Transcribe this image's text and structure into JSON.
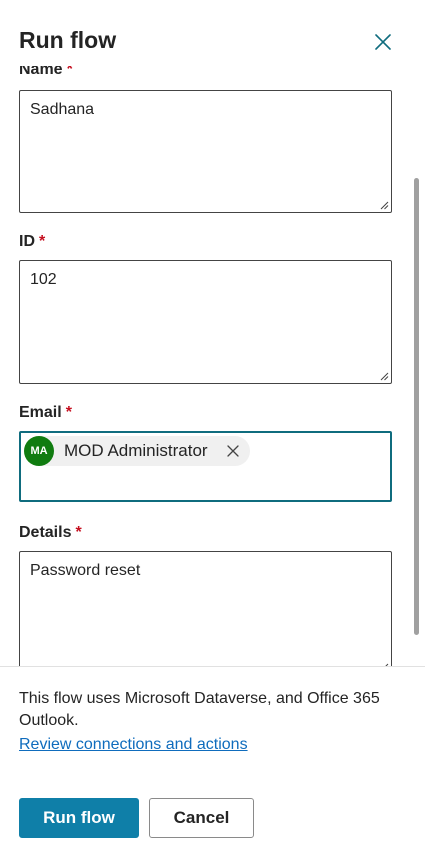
{
  "panel": {
    "title": "Run flow",
    "close_icon": "close-icon"
  },
  "form": {
    "name": {
      "label": "Name",
      "required_mark": "*",
      "value": "Sadhana"
    },
    "id": {
      "label": "ID",
      "required_mark": "*",
      "value": "102"
    },
    "email": {
      "label": "Email",
      "required_mark": "*",
      "persona": {
        "initials": "MA",
        "display_name": "MOD Administrator",
        "avatar_color": "#107c10"
      }
    },
    "details": {
      "label": "Details",
      "required_mark": "*",
      "value": "Password reset"
    }
  },
  "footer": {
    "description": "This flow uses Microsoft Dataverse, and Office 365 Outlook.",
    "link_text": "Review connections and actions"
  },
  "actions": {
    "run_label": "Run flow",
    "cancel_label": "Cancel"
  },
  "colors": {
    "accent": "#0f7fa8",
    "focus_border": "#0f6c7e",
    "required": "#c50f1f",
    "link": "#0f6cbd"
  }
}
